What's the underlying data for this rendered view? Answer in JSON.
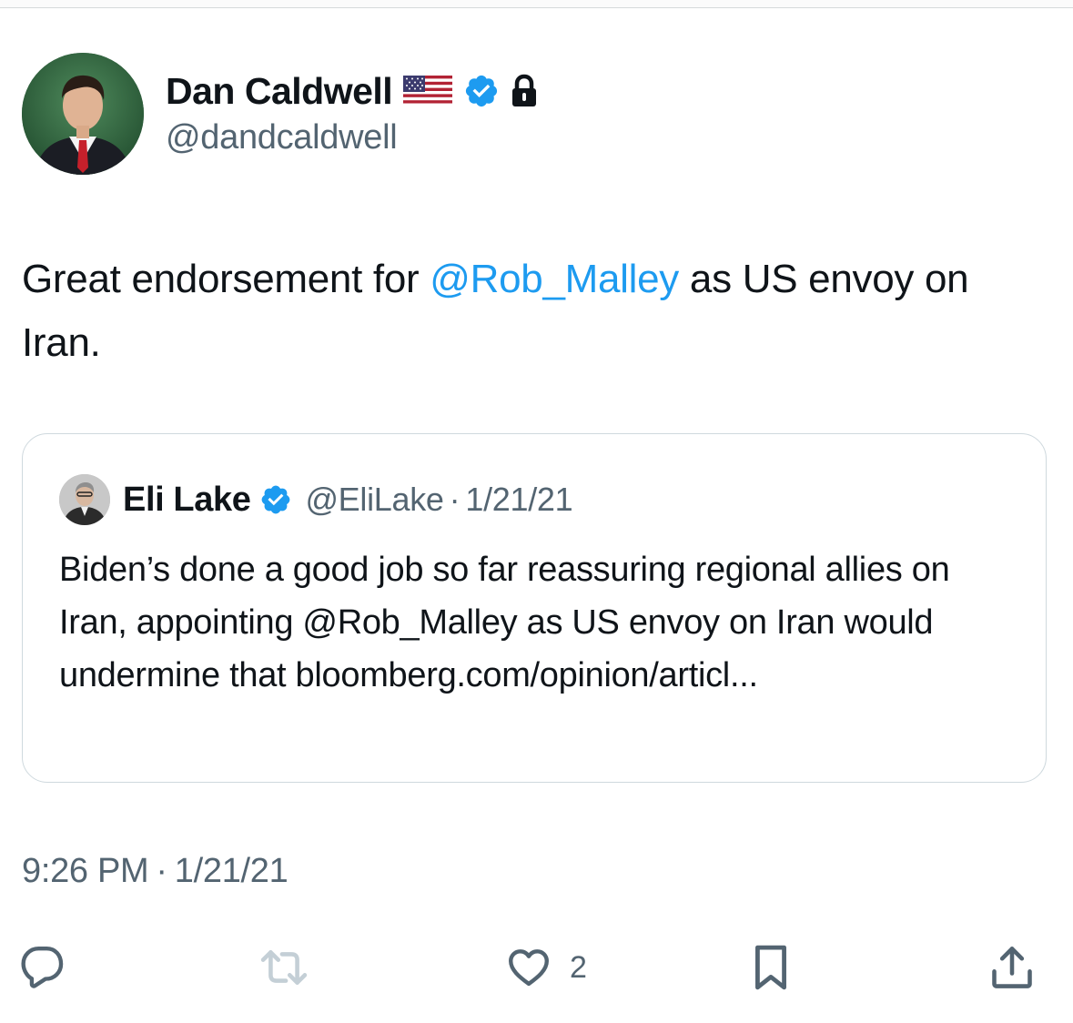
{
  "author": {
    "name": "Dan Caldwell",
    "handle": "@dandcaldwell",
    "badges": [
      "us-flag-icon",
      "verified-badge-icon",
      "lock-icon"
    ]
  },
  "tweet": {
    "text_before": "Great endorsement for ",
    "mention": "@Rob_Malley",
    "text_after": " as US envoy on Iran."
  },
  "quote": {
    "name": "Eli Lake",
    "handle": "@EliLake",
    "separator": "·",
    "date": "1/21/21",
    "text": "Biden’s done a good job so far reassuring regional allies on Iran, appointing @Rob_Malley as US envoy on Iran would undermine that bloomberg.com/opinion/articl..."
  },
  "meta": {
    "time": "9:26 PM",
    "separator": "·",
    "date": "1/21/21"
  },
  "actions": {
    "reply": {
      "icon": "reply-icon"
    },
    "retweet": {
      "icon": "retweet-icon"
    },
    "like": {
      "icon": "heart-icon",
      "count": "2"
    },
    "bookmark": {
      "icon": "bookmark-icon"
    },
    "share": {
      "icon": "share-icon"
    }
  },
  "colors": {
    "text": "#0f1419",
    "secondary": "#536471",
    "accent": "#1d9bf0",
    "border": "#cfd9de",
    "retweet_disabled": "#c4cfd6"
  }
}
